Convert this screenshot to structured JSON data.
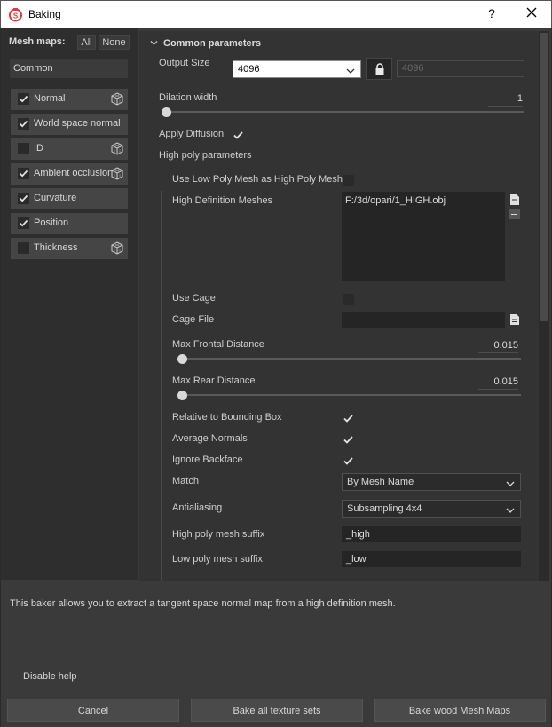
{
  "window": {
    "title": "Baking",
    "help_glyph": "?",
    "close_icon": "close-icon"
  },
  "left_panel": {
    "mesh_maps_label": "Mesh maps:",
    "all_label": "All",
    "none_label": "None",
    "common_label": "Common",
    "items": [
      {
        "label": "Normal",
        "checked": true,
        "has_cube": true
      },
      {
        "label": "World space normal",
        "checked": true,
        "has_cube": false
      },
      {
        "label": "ID",
        "checked": false,
        "has_cube": true
      },
      {
        "label": "Ambient occlusion",
        "checked": true,
        "has_cube": true
      },
      {
        "label": "Curvature",
        "checked": true,
        "has_cube": false
      },
      {
        "label": "Position",
        "checked": true,
        "has_cube": false
      },
      {
        "label": "Thickness",
        "checked": false,
        "has_cube": true
      }
    ]
  },
  "common": {
    "section_title": "Common parameters",
    "output_size_label": "Output Size",
    "output_size_value": "4096",
    "output_size_linked_value": "4096",
    "dilation_label": "Dilation width",
    "dilation_value": "1",
    "dilation_fraction": 0.0,
    "apply_diffusion_label": "Apply Diffusion",
    "apply_diffusion_checked": true,
    "high_poly_params_label": "High poly parameters",
    "use_low_poly_label": "Use Low Poly Mesh as High Poly Mesh",
    "use_low_poly_checked": false,
    "hd_meshes_label": "High Definition Meshes",
    "hd_meshes_value": "F:/3d/opari/1_HIGH.obj",
    "use_cage_label": "Use Cage",
    "use_cage_checked": false,
    "cage_file_label": "Cage File",
    "cage_file_value": "",
    "max_frontal_label": "Max Frontal Distance",
    "max_frontal_value": "0.015",
    "max_frontal_fraction": 0.015,
    "max_rear_label": "Max Rear Distance",
    "max_rear_value": "0.015",
    "max_rear_fraction": 0.015,
    "relative_bbox_label": "Relative to Bounding Box",
    "relative_bbox_checked": true,
    "average_normals_label": "Average Normals",
    "average_normals_checked": true,
    "ignore_backface_label": "Ignore Backface",
    "ignore_backface_checked": true,
    "match_label": "Match",
    "match_value": "By Mesh Name",
    "antialiasing_label": "Antialiasing",
    "antialiasing_value": "Subsampling 4x4",
    "high_suffix_label": "High poly mesh suffix",
    "high_suffix_value": "_high",
    "low_suffix_label": "Low poly mesh suffix",
    "low_suffix_value": "_low"
  },
  "help": {
    "text": "This baker allows you to extract a tangent space normal map from a high definition mesh.",
    "disable_label": "Disable help"
  },
  "buttons": {
    "cancel": "Cancel",
    "bake_all": "Bake all texture sets",
    "bake_wood": "Bake wood Mesh Maps"
  },
  "colors": {
    "accent_icon": "#e0383d",
    "panel_bg": "#333333",
    "dialog_bg": "#3a3a3a"
  }
}
